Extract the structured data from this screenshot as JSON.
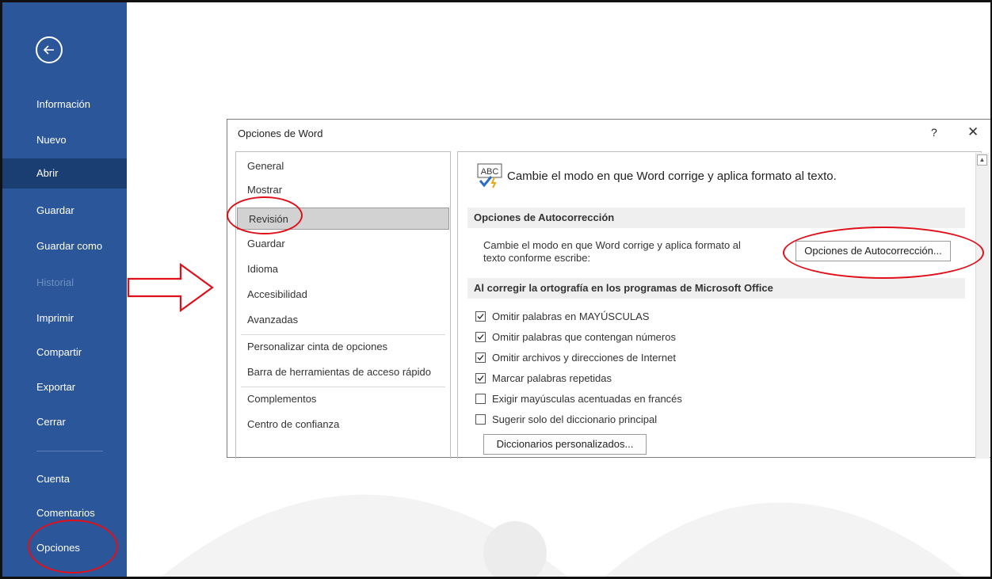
{
  "backstage": {
    "items": [
      {
        "label": "Información"
      },
      {
        "label": "Nuevo"
      },
      {
        "label": "Abrir"
      },
      {
        "label": "Guardar"
      },
      {
        "label": "Guardar como"
      },
      {
        "label": "Historial"
      },
      {
        "label": "Imprimir"
      },
      {
        "label": "Compartir"
      },
      {
        "label": "Exportar"
      },
      {
        "label": "Cerrar"
      },
      {
        "label": "Cuenta"
      },
      {
        "label": "Comentarios"
      },
      {
        "label": "Opciones"
      }
    ],
    "colors": {
      "background": "#2b579a",
      "active": "#1b3e72",
      "annotation": "#e0101a"
    }
  },
  "dialog": {
    "title": "Opciones de Word",
    "help": "?",
    "close": "✕",
    "nav": [
      {
        "label": "General"
      },
      {
        "label": "Mostrar"
      },
      {
        "label": "Revisión"
      },
      {
        "label": "Guardar"
      },
      {
        "label": "Idioma"
      },
      {
        "label": "Accesibilidad"
      },
      {
        "label": "Avanzadas"
      },
      {
        "label": "Personalizar cinta de opciones"
      },
      {
        "label": "Barra de herramientas de acceso rápido"
      },
      {
        "label": "Complementos"
      },
      {
        "label": "Centro de confianza"
      }
    ],
    "selected_nav": "Revisión",
    "content": {
      "icon_text": "ABC",
      "header": "Cambie el modo en que Word corrige y aplica formato al texto.",
      "autocorrect_section": "Opciones de Autocorrección",
      "autocorrect_desc_line1": "Cambie el modo en que Word corrige y aplica formato al",
      "autocorrect_desc_line2": "texto conforme escribe:",
      "autocorrect_button": "Opciones de Autocorrección...",
      "spelling_section": "Al corregir la ortografía en los programas de Microsoft Office",
      "checkboxes": [
        {
          "label": "Omitir palabras en MAYÚSCULAS",
          "checked": true
        },
        {
          "label": "Omitir palabras que contengan números",
          "checked": true
        },
        {
          "label": "Omitir archivos y direcciones de Internet",
          "checked": true
        },
        {
          "label": "Marcar palabras repetidas",
          "checked": true
        },
        {
          "label": "Exigir mayúsculas acentuadas en francés",
          "checked": false
        },
        {
          "label": "Sugerir solo del diccionario principal",
          "checked": false
        }
      ],
      "dictionaries_button": "Diccionarios personalizados..."
    }
  }
}
